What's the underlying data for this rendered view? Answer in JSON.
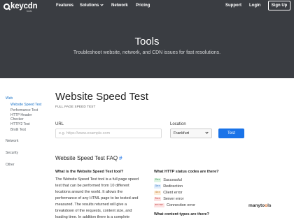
{
  "header": {
    "logo_text": "keycdn",
    "logo_sub": "tools",
    "nav": [
      "Features",
      "Solutions",
      "Network",
      "Pricing"
    ],
    "right": [
      "Support",
      "Login"
    ],
    "signup": "Sign Up"
  },
  "hero": {
    "title": "Tools",
    "subtitle": "Troubleshoot website, network, and CDN issues for fast resolutions."
  },
  "sidebar": {
    "web": "Web",
    "web_items": [
      "Website Speed Test",
      "Performance Test",
      "HTTP Header",
      "Checker",
      "HTTP/2 Test",
      "Brotli Test"
    ],
    "network": "Network",
    "security": "Security",
    "other": "Other"
  },
  "main": {
    "title": "Website Speed Test",
    "subtitle": "FULL PAGE SPEED TEST",
    "url_label": "URL",
    "url_placeholder": "e.g. https://www.example.com",
    "location_label": "Location",
    "location_value": "Frankfurt",
    "test_button": "Test",
    "faq_title": "Website Speed Test FAQ",
    "faq_hash": "#",
    "q1": "What is the Website Speed Test tool?",
    "a1": "The Website Speed Test tool is a full page speed test that can be performed from 10 different locations around the world. It allows the performance of any HTML page to be tested and measured. The results returned will give a breakdown of the requests, content size, and loading time. In addition there is a complete",
    "q2": "What HTTP status codes are there?",
    "codes": [
      {
        "code": "2xx",
        "label": "Successful"
      },
      {
        "code": "3xx",
        "label": "Redirection"
      },
      {
        "code": "4xx",
        "label": "Client error"
      },
      {
        "code": "5xx",
        "label": "Server error"
      },
      {
        "code": "error",
        "label": "Connection error"
      }
    ],
    "q3": "What content types are there?"
  },
  "badge": {
    "left": "manyto",
    "o": "o",
    "right": "ls"
  }
}
